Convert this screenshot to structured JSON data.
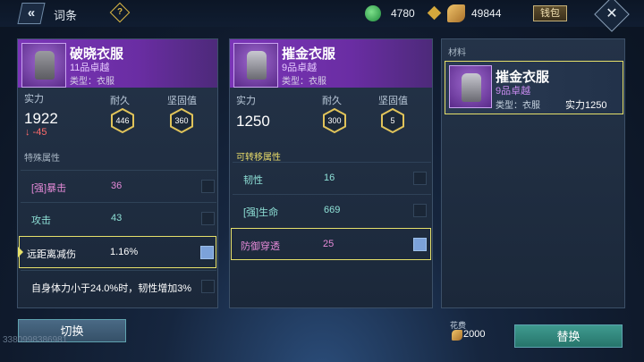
{
  "topbar": {
    "title": "词条",
    "help_symbol": "?",
    "back_symbol": "«",
    "close_symbol": "✕",
    "currency1_value": "4780",
    "currency2_value": "49844",
    "wallet_label": "钱包"
  },
  "left": {
    "name": "破晓衣服",
    "grade": "11品卓越",
    "type": "类型：衣服",
    "power_label": "实力",
    "power_value": "1922",
    "power_delta": "↓ -45",
    "durability_label": "耐久",
    "durability_value": "446",
    "firmness_label": "坚固值",
    "firmness_value": "360",
    "section": "特殊属性",
    "rows": [
      {
        "name": "[强]暴击",
        "value": "36"
      },
      {
        "name": "攻击",
        "value": "43"
      },
      {
        "name": "远距离减伤",
        "value": "1.16%"
      },
      {
        "name": "自身体力小于24.0%时，韧性增加3%",
        "value": ""
      }
    ]
  },
  "mid": {
    "name": "摧金衣服",
    "grade": "9品卓越",
    "type": "类型：衣服",
    "power_label": "实力",
    "power_value": "1250",
    "durability_label": "耐久",
    "durability_value": "300",
    "firmness_label": "坚固值",
    "firmness_value": "5",
    "section": "可转移属性",
    "rows": [
      {
        "name": "韧性",
        "value": "16"
      },
      {
        "name": "[强]生命",
        "value": "669"
      },
      {
        "name": "防御穿透",
        "value": "25"
      }
    ]
  },
  "right": {
    "title": "材料",
    "name": "摧金衣服",
    "grade": "9品卓越",
    "type": "类型：衣服",
    "power": "实力1250"
  },
  "bottom": {
    "switch_label": "切换",
    "replace_label": "替换",
    "cost_label": "花费",
    "cost_value": "2000",
    "uid": "3380998386981"
  },
  "colors": {
    "accent_yellow": "#e6e06a",
    "purple_header": "#7a35b7",
    "pink_value": "#e58ad8",
    "teal_value": "#8ee0d6",
    "white_value": "#ffffff",
    "section_yellow": "#e9dc6a",
    "section_grey": "#aab8c6"
  }
}
